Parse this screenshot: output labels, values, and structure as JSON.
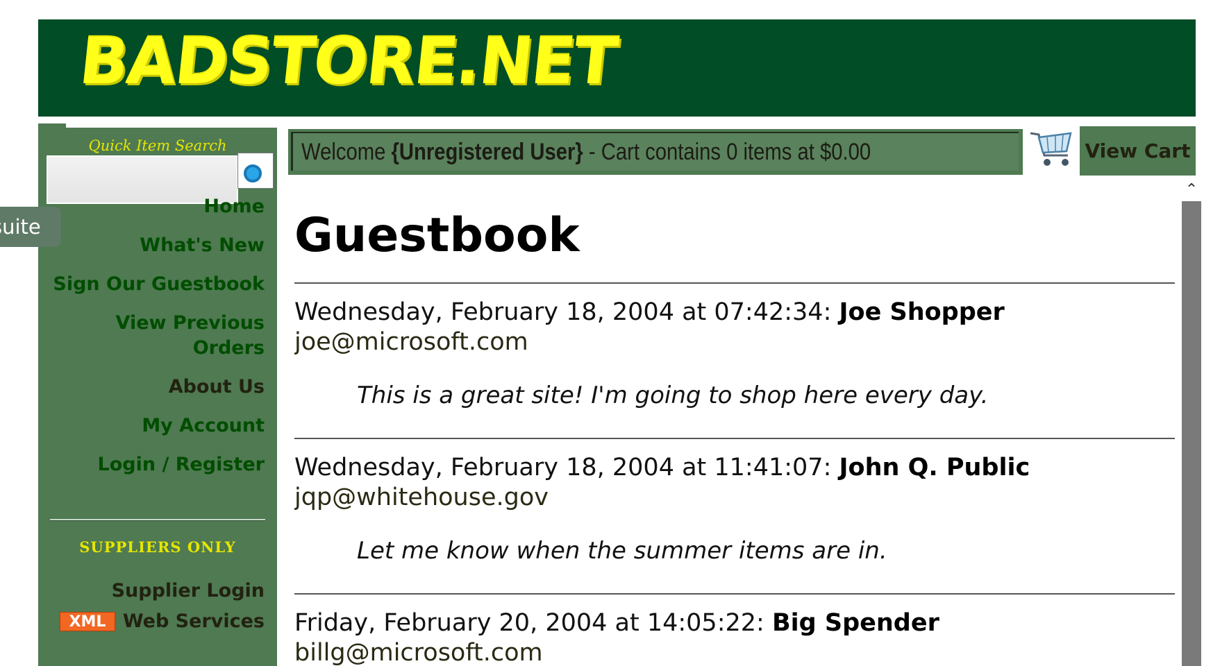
{
  "banner": {
    "logo_text": "BADSTORE.NET"
  },
  "sidebar": {
    "quick_search_label": "Quick Item Search",
    "nav": [
      {
        "label": "Home",
        "name": "nav-home"
      },
      {
        "label": "What's New",
        "name": "nav-whats-new"
      },
      {
        "label": "Sign Our Guestbook",
        "name": "nav-sign-guestbook"
      },
      {
        "label": "View Previous Orders",
        "name": "nav-view-previous-orders"
      },
      {
        "label": "About Us",
        "name": "nav-about-us"
      },
      {
        "label": "My Account",
        "name": "nav-my-account"
      },
      {
        "label": "Login / Register",
        "name": "nav-login-register"
      }
    ],
    "suppliers_heading": "SUPPLIERS ONLY",
    "supplier_login": "Supplier Login",
    "xml_badge": "XML",
    "web_services": "Web Services"
  },
  "overlay_tab": {
    "label": "suite"
  },
  "header": {
    "welcome_prefix": "Welcome ",
    "user": "{Unregistered User}",
    "cart_status": " - Cart contains 0 items at $0.00",
    "view_cart": "View Cart"
  },
  "main": {
    "title": "Guestbook",
    "entries": [
      {
        "timestamp": "Wednesday, February 18, 2004 at 07:42:34:",
        "author": "Joe Shopper",
        "email": "joe@microsoft.com",
        "message": "This is a great site!  I'm going to shop here every day."
      },
      {
        "timestamp": "Wednesday, February 18, 2004 at 11:41:07:",
        "author": "John Q. Public",
        "email": "jqp@whitehouse.gov",
        "message": "Let me know when the summer items are in."
      },
      {
        "timestamp": "Friday, February 20, 2004 at 14:05:22:",
        "author": "Big Spender",
        "email": "billg@microsoft.com",
        "message": ""
      }
    ]
  },
  "colors": {
    "banner": "#004d26",
    "sidebar": "#4f7a52",
    "logo": "#ffff1a",
    "accent_yellow": "#e6e600",
    "xml_badge": "#f26722"
  }
}
